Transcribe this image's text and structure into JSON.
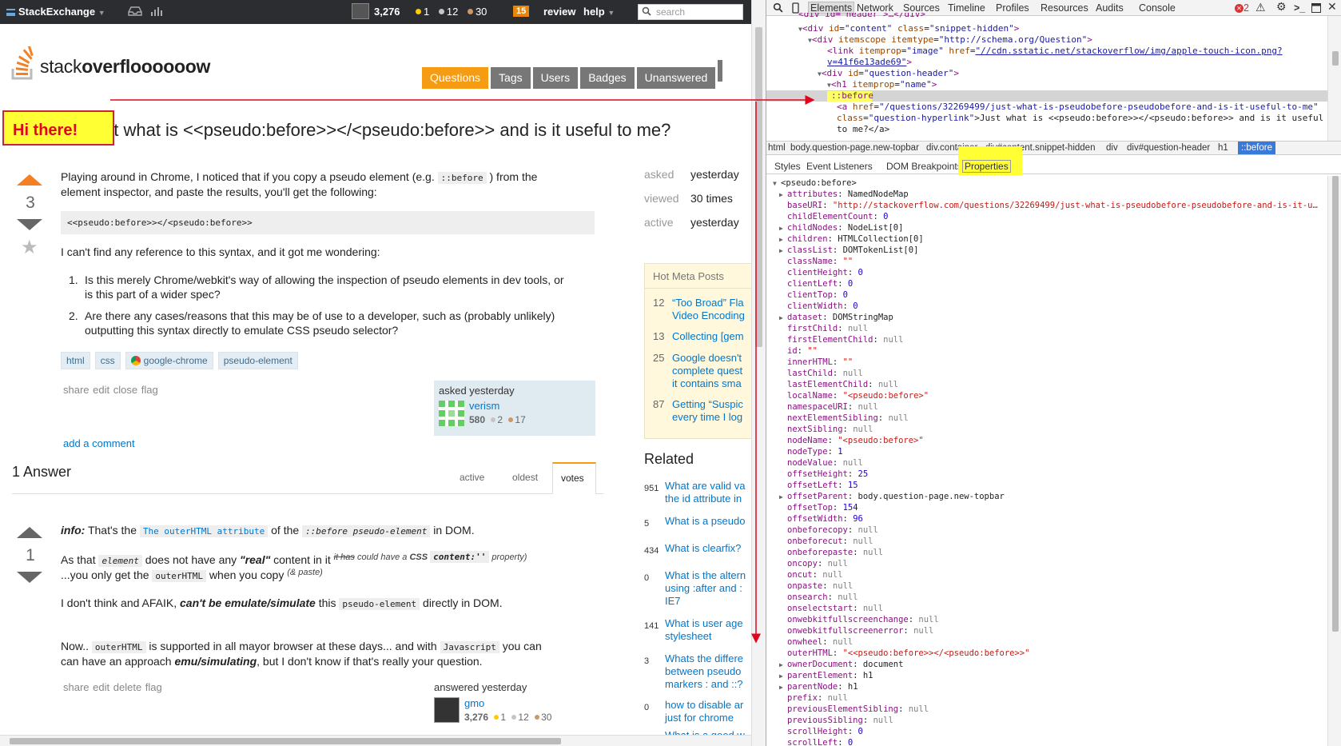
{
  "topbar": {
    "brand": "StackExchange",
    "reputation": "3,276",
    "gold": "1",
    "silver": "12",
    "bronze": "30",
    "inbox": "15",
    "review": "review",
    "help": "help",
    "search_placeholder": "search",
    "colors": {
      "bg": "#2c2d31",
      "gold": "#ffcc00",
      "silver": "#c5c5c5",
      "bronze": "#cc9966",
      "inbox": "#e8860c"
    }
  },
  "logo": {
    "prefix": "stack",
    "bold": "overfloooooow"
  },
  "nav": [
    "Questions",
    "Tags",
    "Users",
    "Badges",
    "Unanswered"
  ],
  "question": {
    "annotation": "Hi there!",
    "title": "Just what is <<pseudo:before>></<pseudo:before>> and is it useful to me?",
    "votes": "3",
    "p1a": "Playing around in Chrome, I noticed that if you copy a pseudo element (e.g.",
    "p1code": "::before",
    "p1b": ") from the",
    "p1c": "element inspector, and paste the results, you'll get the following:",
    "codeblock": "<<pseudo:before>></<pseudo:before>>",
    "p2": "I can't find any reference to this syntax, and it got me wondering:",
    "list": [
      {
        "num": "1.",
        "l1": "Is this merely Chrome/webkit's way of allowing the inspection of pseudo elements in dev tools, or",
        "l2": "is this part of a wider spec?"
      },
      {
        "num": "2.",
        "l1": "Are there any cases/reasons that this may be of use to a developer, such as (probably unlikely)",
        "l2": "outputting this syntax directly to emulate CSS pseudo selector?"
      }
    ],
    "tags": [
      "html",
      "css",
      "google-chrome",
      "pseudo-element"
    ],
    "actions": [
      "share",
      "edit",
      "close",
      "flag"
    ],
    "asked_label": "asked yesterday",
    "user": "verism",
    "user_rep": "580",
    "user_silver": "2",
    "user_bronze": "17",
    "add_comment": "add a comment"
  },
  "sidebar": {
    "stats": [
      {
        "k": "asked",
        "v": "yesterday"
      },
      {
        "k": "viewed",
        "v": "30 times"
      },
      {
        "k": "active",
        "v": "yesterday"
      }
    ],
    "hot_title": "Hot Meta Posts",
    "hot": [
      {
        "n": "12",
        "l1": "“Too Broad” Fla",
        "l2": "Video Encoding"
      },
      {
        "n": "13",
        "l1": "Collecting [gem",
        "l2": ""
      },
      {
        "n": "25",
        "l1": "Google doesn't",
        "l2": "complete quest",
        "l3": "it contains sma"
      },
      {
        "n": "87",
        "l1": "Getting “Suspic",
        "l2": "every time I log"
      }
    ],
    "related_title": "Related",
    "related": [
      {
        "n": "951",
        "l1": "What are valid va",
        "l2": "the id attribute in"
      },
      {
        "n": "5",
        "l1": "What is a pseudo",
        "l2": ""
      },
      {
        "n": "434",
        "l1": "What is clearfix?",
        "l2": ""
      },
      {
        "n": "0",
        "l1": "What is the altern",
        "l2": "using :after and :",
        "l3": "IE7"
      },
      {
        "n": "141",
        "l1": "What is user age",
        "l2": "stylesheet"
      },
      {
        "n": "3",
        "l1": "Whats the differe",
        "l2": "between pseudo",
        "l3": "markers : and ::?"
      },
      {
        "n": "0",
        "l1": "how to disable ar",
        "l2": "just for chrome"
      },
      {
        "n": "",
        "l1": "What is a good w",
        "l2": ""
      }
    ]
  },
  "answers": {
    "count_label": "1 Answer",
    "sort_tabs": [
      "active",
      "oldest",
      "votes"
    ],
    "votes": "1",
    "a_info": "info:",
    "a_t1": "That's the",
    "a_code1": "The outerHTML attribute",
    "a_t2": "of the",
    "a_code2": "::before pseudo-element",
    "a_t3": "in DOM.",
    "b_t1": "As that",
    "b_code1": "element",
    "b_t2": "does not have any",
    "b_real": "\"real\"",
    "b_t3": "content in it",
    "b_sup_strike": "it has",
    "b_sup1": "could have a",
    "b_sup_css": "CSS",
    "b_sup_code": "content:''",
    "b_sup2": "property)",
    "c_t1": "...you only get the",
    "c_code": "outerHTML",
    "c_t2": "when you copy",
    "c_sup": "(& paste)",
    "d_t1": "I don't think and AFAIK,",
    "d_bold": "can't be emulate/simulate",
    "d_t2": "this",
    "d_code": "pseudo-element",
    "d_t3": "directly in DOM.",
    "e_t1": "Now..",
    "e_code1": "outerHTML",
    "e_t2": "is supported in all mayor browser at these days... and with",
    "e_code2": "Javascript",
    "e_t3": "you can",
    "f_t1": "can have an approach",
    "f_bold": "emu/simulating",
    "f_t2": ", but I don't know if that's really your question.",
    "actions": [
      "share",
      "edit",
      "delete",
      "flag"
    ],
    "answered_label": "answered yesterday",
    "user": "gmo",
    "user_rep": "3,276",
    "user_gold": "1",
    "user_silver": "12",
    "user_bronze": "30"
  },
  "devtools": {
    "tabs": [
      "Elements",
      "Network",
      "Sources",
      "Timeline",
      "Profiles",
      "Resources",
      "Audits",
      "Console"
    ],
    "errors": "2",
    "dom": {
      "l0": "<div id=\"header\">…</div>",
      "l1_tag": "<div ",
      "l1_a1": "id",
      "l1_v1": "\"content\"",
      "l1_a2": "class",
      "l1_v2": "\"snippet-hidden\"",
      "l1_end": ">",
      "l2_tag": "<div ",
      "l2_a1": "itemscope",
      "l2_a2": "itemtype",
      "l2_v2": "\"http://schema.org/Question\"",
      "l2_end": ">",
      "l3_tag": "<link ",
      "l3_a1": "itemprop",
      "l3_v1": "\"image\"",
      "l3_a2": "href",
      "l3_v2": "\"//cdn.sstatic.net/stackoverflow/img/apple-touch-icon.png?",
      "l3b": "v=41f6e13ade69\"",
      "l3b_end": ">",
      "l4_tag": "<div ",
      "l4_a1": "id",
      "l4_v1": "\"question-header\"",
      "l4_end": ">",
      "l5_tag": "<h1 ",
      "l5_a1": "itemprop",
      "l5_v1": "\"name\"",
      "l5_end": ">",
      "l6": "::before",
      "l7_tag": "<a ",
      "l7_a1": "href",
      "l7_v1": "\"/questions/32269499/just-what-is-pseudobefore-pseudobefore-and-is-it-useful-to-me\"",
      "l8_a": "class",
      "l8_v": "\"question-hyperlink\"",
      "l8_t": ">Just what is <<pseudo:before>></<pseudo:before>> and is it useful",
      "l9": "to me?</a>"
    },
    "breadcrumbs": [
      "html",
      "body.question-page.new-topbar",
      "div.container",
      "div#content.snippet-hidden",
      "div",
      "div#question-header",
      "h1",
      "::before"
    ],
    "panel_tabs": [
      "Styles",
      "Event Listeners",
      "DOM Breakpoints",
      "Properties"
    ],
    "props_root": "<pseudo:before>",
    "props": [
      {
        "k": "attributes",
        "v": "NamedNodeMap",
        "t": "obj",
        "tri": true
      },
      {
        "k": "baseURI",
        "v": "\"http://stackoverflow.com/questions/32269499/just-what-is-pseudobefore-pseudobefore-and-is-it-u…",
        "t": "str"
      },
      {
        "k": "childElementCount",
        "v": "0",
        "t": "num"
      },
      {
        "k": "childNodes",
        "v": "NodeList[0]",
        "t": "obj",
        "tri": true
      },
      {
        "k": "children",
        "v": "HTMLCollection[0]",
        "t": "obj",
        "tri": true
      },
      {
        "k": "classList",
        "v": "DOMTokenList[0]",
        "t": "obj",
        "tri": true
      },
      {
        "k": "className",
        "v": "\"\"",
        "t": "str"
      },
      {
        "k": "clientHeight",
        "v": "0",
        "t": "num"
      },
      {
        "k": "clientLeft",
        "v": "0",
        "t": "num"
      },
      {
        "k": "clientTop",
        "v": "0",
        "t": "num"
      },
      {
        "k": "clientWidth",
        "v": "0",
        "t": "num"
      },
      {
        "k": "dataset",
        "v": "DOMStringMap",
        "t": "obj",
        "tri": true
      },
      {
        "k": "firstChild",
        "v": "null",
        "t": "nul"
      },
      {
        "k": "firstElementChild",
        "v": "null",
        "t": "nul"
      },
      {
        "k": "id",
        "v": "\"\"",
        "t": "str"
      },
      {
        "k": "innerHTML",
        "v": "\"\"",
        "t": "str"
      },
      {
        "k": "lastChild",
        "v": "null",
        "t": "nul"
      },
      {
        "k": "lastElementChild",
        "v": "null",
        "t": "nul"
      },
      {
        "k": "localName",
        "v": "\"<pseudo:before>\"",
        "t": "str"
      },
      {
        "k": "namespaceURI",
        "v": "null",
        "t": "nul"
      },
      {
        "k": "nextElementSibling",
        "v": "null",
        "t": "nul"
      },
      {
        "k": "nextSibling",
        "v": "null",
        "t": "nul"
      },
      {
        "k": "nodeName",
        "v": "\"<pseudo:before>\"",
        "t": "str"
      },
      {
        "k": "nodeType",
        "v": "1",
        "t": "num"
      },
      {
        "k": "nodeValue",
        "v": "null",
        "t": "nul"
      },
      {
        "k": "offsetHeight",
        "v": "25",
        "t": "num"
      },
      {
        "k": "offsetLeft",
        "v": "15",
        "t": "num"
      },
      {
        "k": "offsetParent",
        "v": "body.question-page.new-topbar",
        "t": "obj",
        "tri": true
      },
      {
        "k": "offsetTop",
        "v": "154",
        "t": "num"
      },
      {
        "k": "offsetWidth",
        "v": "96",
        "t": "num"
      },
      {
        "k": "onbeforecopy",
        "v": "null",
        "t": "nul"
      },
      {
        "k": "onbeforecut",
        "v": "null",
        "t": "nul"
      },
      {
        "k": "onbeforepaste",
        "v": "null",
        "t": "nul"
      },
      {
        "k": "oncopy",
        "v": "null",
        "t": "nul"
      },
      {
        "k": "oncut",
        "v": "null",
        "t": "nul"
      },
      {
        "k": "onpaste",
        "v": "null",
        "t": "nul"
      },
      {
        "k": "onsearch",
        "v": "null",
        "t": "nul"
      },
      {
        "k": "onselectstart",
        "v": "null",
        "t": "nul"
      },
      {
        "k": "onwebkitfullscreenchange",
        "v": "null",
        "t": "nul"
      },
      {
        "k": "onwebkitfullscreenerror",
        "v": "null",
        "t": "nul"
      },
      {
        "k": "onwheel",
        "v": "null",
        "t": "nul"
      },
      {
        "k": "outerHTML",
        "v": "\"<<pseudo:before>></<pseudo:before>>\"",
        "t": "str",
        "hl": true
      },
      {
        "k": "ownerDocument",
        "v": "document",
        "t": "obj",
        "tri": true
      },
      {
        "k": "parentElement",
        "v": "h1",
        "t": "obj",
        "tri": true
      },
      {
        "k": "parentNode",
        "v": "h1",
        "t": "obj",
        "tri": true
      },
      {
        "k": "prefix",
        "v": "null",
        "t": "nul"
      },
      {
        "k": "previousElementSibling",
        "v": "null",
        "t": "nul"
      },
      {
        "k": "previousSibling",
        "v": "null",
        "t": "nul"
      },
      {
        "k": "scrollHeight",
        "v": "0",
        "t": "num"
      },
      {
        "k": "scrollLeft",
        "v": "0",
        "t": "num"
      }
    ],
    "colors": {
      "annotation_yellow": "#ffff33",
      "annotation_red": "#c9233f",
      "selected_crumb": "#3879d9"
    }
  }
}
